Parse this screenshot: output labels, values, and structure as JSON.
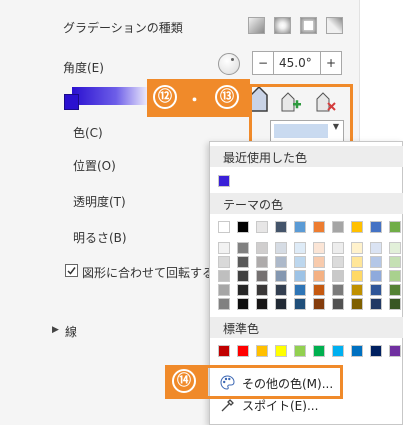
{
  "labels": {
    "gradient_type": "グラデーションの種類",
    "angle": "角度(E)",
    "angle_value": "45.0°",
    "color": "色(C)",
    "position": "位置(O)",
    "transparency": "透明度(T)",
    "brightness": "明るさ(B)",
    "rotate_with_shape": "図形に合わせて回転する(W",
    "line": "線",
    "minus": "−",
    "plus": "+"
  },
  "badges": {
    "b12": "⑫",
    "dot": "・",
    "b13": "⑬",
    "b14": "⑭"
  },
  "menu": {
    "recent_header": "最近使用した色",
    "theme_header": "テーマの色",
    "standard_header": "標準色",
    "more_colors": "その他の色(M)...",
    "eyedropper": "スポイト(E)..."
  },
  "colors": {
    "accent_orange": "#f08a2a",
    "recent": [
      "#3a20d8"
    ],
    "theme_top": [
      "#ffffff",
      "#000000",
      "#e7e6e6",
      "#44546a",
      "#5b9bd5",
      "#ed7d31",
      "#a5a5a5",
      "#ffc000",
      "#4472c4",
      "#70ad47"
    ],
    "theme_columns": [
      [
        "#f2f2f2",
        "#d9d9d9",
        "#bfbfbf",
        "#a6a6a6",
        "#808080"
      ],
      [
        "#808080",
        "#595959",
        "#404040",
        "#262626",
        "#0d0d0d"
      ],
      [
        "#d0cece",
        "#aeabab",
        "#757171",
        "#3a3838",
        "#171616"
      ],
      [
        "#d6dce4",
        "#adb9ca",
        "#8497b0",
        "#333f50",
        "#222a35"
      ],
      [
        "#deebf7",
        "#bdd7ee",
        "#9dc3e6",
        "#2e75b6",
        "#1f4e79"
      ],
      [
        "#fbe5d6",
        "#f8cbad",
        "#f4b183",
        "#c55a11",
        "#843c0c"
      ],
      [
        "#ededed",
        "#dbdbdb",
        "#c9c9c9",
        "#7b7b7b",
        "#525252"
      ],
      [
        "#fff2cc",
        "#ffe699",
        "#ffd966",
        "#bf9000",
        "#7f6000"
      ],
      [
        "#dae3f3",
        "#b4c7e7",
        "#8faadc",
        "#2f5597",
        "#203864"
      ],
      [
        "#e2f0d9",
        "#c5e0b4",
        "#a9d18e",
        "#548235",
        "#385723"
      ]
    ],
    "standard": [
      "#c00000",
      "#ff0000",
      "#ffc000",
      "#ffff00",
      "#92d050",
      "#00b050",
      "#00b0f0",
      "#0070c0",
      "#002060",
      "#7030a0"
    ]
  }
}
